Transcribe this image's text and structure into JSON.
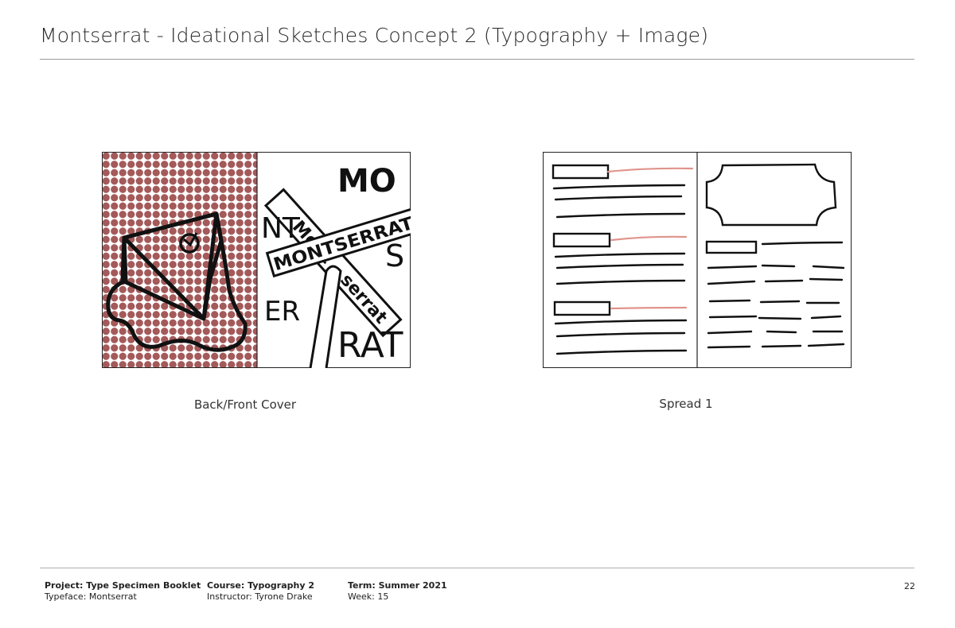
{
  "header": {
    "title": "Montserrat - Ideational Sketches Concept 2 (Typography + Image)"
  },
  "sketches": [
    {
      "caption": "Back/Front Cover",
      "labels": {
        "mo": "MO",
        "mont": "Mont",
        "nt": "NT",
        "montserrat": "MONTSERRAT",
        "s": "S",
        "serrat": "serrat",
        "er": "ER",
        "rat": "RAT"
      }
    },
    {
      "caption": "Spread 1"
    }
  ],
  "colors": {
    "dot": "#a45a5a",
    "accent_line": "#e0948c",
    "ink": "#111111"
  },
  "footer": {
    "project": "Project: Type Specimen Booklet",
    "typeface": "Typeface: Montserrat",
    "course": "Course: Typography 2",
    "instructor": "Instructor: Tyrone Drake",
    "term": "Term: Summer 2021",
    "week": "Week: 15",
    "page_number": "22"
  }
}
